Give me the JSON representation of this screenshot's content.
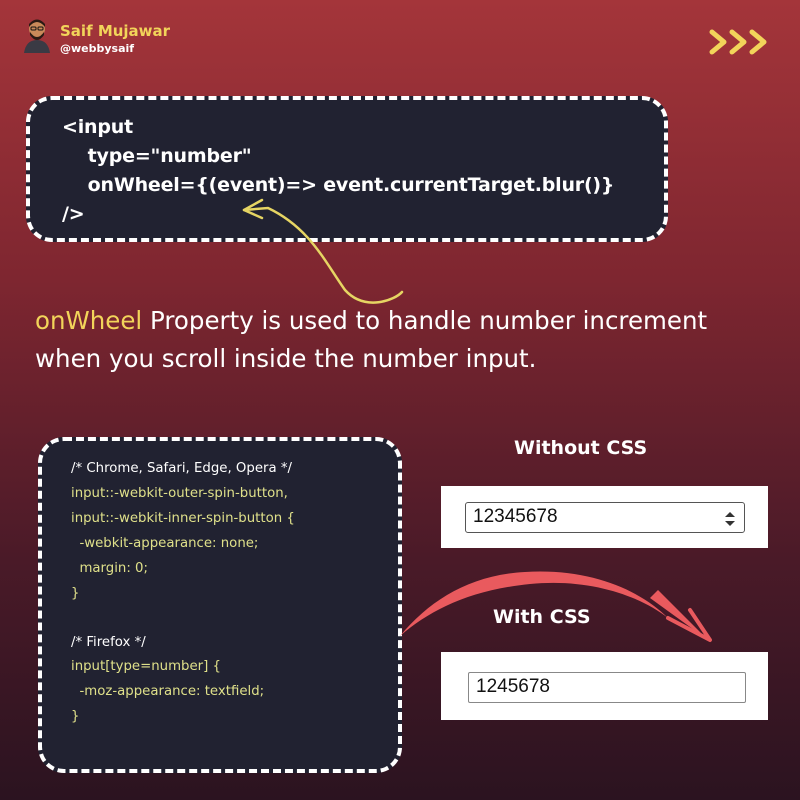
{
  "author": {
    "name": "Saif Mujawar",
    "handle": "@webbysaif"
  },
  "code_top": {
    "lines": [
      "<input",
      "    type=\"number\"",
      "    onWheel={(event)=> event.currentTarget.blur()}",
      "/>"
    ]
  },
  "description": {
    "highlight": "onWheel",
    "text": " Property is used to handle number increment when you scroll inside the number input."
  },
  "code_bottom": {
    "lines": [
      "/* Chrome, Safari, Edge, Opera */",
      "input::-webkit-outer-spin-button,",
      "input::-webkit-inner-spin-button {",
      "  -webkit-appearance: none;",
      "  margin: 0;",
      "}",
      "",
      "/* Firefox */",
      "input[type=number] {",
      "  -moz-appearance: textfield;",
      "}"
    ]
  },
  "demo": {
    "without_label": "Without CSS",
    "without_value": "12345678",
    "with_label": "With CSS",
    "with_value": "1245678"
  },
  "colors": {
    "accent_yellow": "#f2d45a",
    "code_bg": "#212231",
    "arrow_red": "#e95a5e",
    "arrow_yellow": "#e6d563"
  },
  "icons": [
    "avatar-icon",
    "next-arrows-icon",
    "spin-button-icon"
  ]
}
